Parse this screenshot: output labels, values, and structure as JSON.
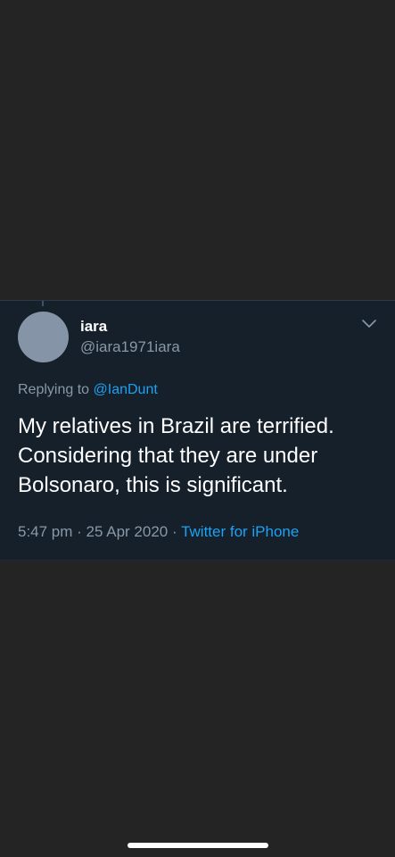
{
  "tweet": {
    "display_name": "iara",
    "handle": "@iara1971iara",
    "replying_prefix": "Replying to ",
    "replying_to": "@IanDunt",
    "text_lines": [
      "My relatives in Brazil are terrified.",
      "Considering that they are under",
      "Bolsonaro, this is significant."
    ],
    "time": "5:47 pm",
    "separator": " · ",
    "date": "25 Apr 2020",
    "source": "Twitter for iPhone"
  },
  "icons": {
    "more": "chevron-down-icon",
    "avatar": "avatar"
  },
  "colors": {
    "card_background": "#15202b",
    "screen_background": "#242424",
    "accent": "#1da1f2",
    "secondary_text": "#8899a6"
  }
}
